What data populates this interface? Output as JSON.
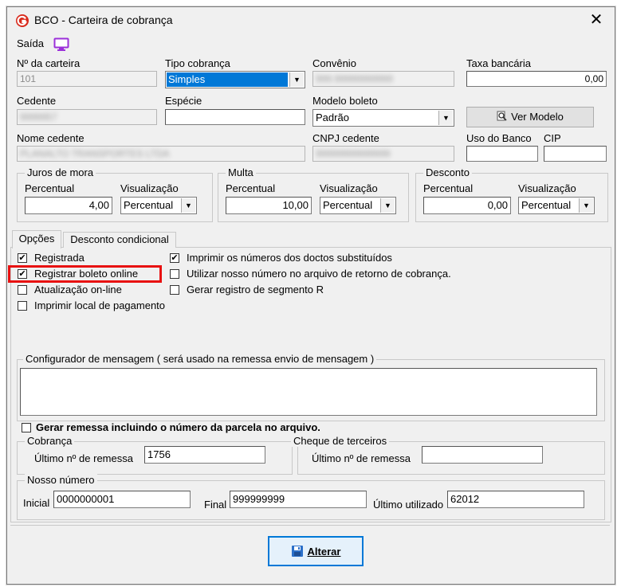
{
  "window": {
    "title": "BCO - Carteira de cobrança",
    "close": "✕",
    "app_icon": "app-g-logo-icon"
  },
  "toolbar": {
    "saida_label": "Saída",
    "monitor_icon": "monitor-icon"
  },
  "fields": {
    "num_carteira": {
      "label": "Nº da carteira",
      "value": "101"
    },
    "tipo_cobranca": {
      "label": "Tipo cobrança",
      "value": "Simples"
    },
    "convenio": {
      "label": "Convênio",
      "value": "999.99999999999"
    },
    "taxa_bancaria": {
      "label": "Taxa bancária",
      "value": "0,00"
    },
    "cedente": {
      "label": "Cedente",
      "value": "9999957"
    },
    "especie": {
      "label": "Espécie",
      "value": ""
    },
    "modelo_boleto": {
      "label": "Modelo boleto",
      "value": "Padrão"
    },
    "ver_modelo": {
      "label": "Ver Modelo"
    },
    "nome_cedente": {
      "label": "Nome cedente",
      "value": "PLANALTO TRANSPORTES LTDA"
    },
    "cnpj_cedente": {
      "label": "CNPJ cedente",
      "value": "99999999999999"
    },
    "uso_banco": {
      "label": "Uso do Banco",
      "value": ""
    },
    "cip": {
      "label": "CIP",
      "value": ""
    }
  },
  "juros": {
    "title": "Juros de mora",
    "percentual_label": "Percentual",
    "percentual": "4,00",
    "vis_label": "Visualização",
    "vis_value": "Percentual"
  },
  "multa": {
    "title": "Multa",
    "percentual_label": "Percentual",
    "percentual": "10,00",
    "vis_label": "Visualização",
    "vis_value": "Percentual"
  },
  "desconto": {
    "title": "Desconto",
    "percentual_label": "Percentual",
    "percentual": "0,00",
    "vis_label": "Visualização",
    "vis_value": "Percentual"
  },
  "tabs": [
    {
      "label": "Opções"
    },
    {
      "label": "Desconto condicional"
    }
  ],
  "options": {
    "registrada": {
      "label": "Registrada",
      "checked": true
    },
    "registrar_online": {
      "label": "Registrar boleto online",
      "checked": true
    },
    "atualizacao_online": {
      "label": "Atualização on-line",
      "checked": false
    },
    "imprimir_local": {
      "label": "Imprimir local de pagamento",
      "checked": false
    },
    "imprimir_numeros": {
      "label": "Imprimir os números dos doctos substituídos",
      "checked": true
    },
    "utilizar_nosso_numero": {
      "label": "Utilizar nosso número no arquivo de retorno de cobrança.",
      "checked": false
    },
    "gerar_segmento_r": {
      "label": "Gerar registro de segmento R",
      "checked": false
    }
  },
  "configurador": {
    "title": "Configurador de mensagem ( será usado na remessa envio de mensagem )",
    "value": ""
  },
  "gerar_remessa": {
    "label": "Gerar remessa incluindo o número da parcela no arquivo.",
    "checked": false
  },
  "cobranca": {
    "title": "Cobrança",
    "ultimo_label": "Último nº  de remessa",
    "ultimo_value": "1756"
  },
  "cheque": {
    "title": "Cheque de terceiros",
    "ultimo_label": "Último nº  de remessa",
    "ultimo_value": ""
  },
  "nosso_numero": {
    "title": "Nosso número",
    "inicial_label": "Inicial",
    "inicial_value": "0000000001",
    "final_label": "Final",
    "final_value": "999999999",
    "ultimo_label": "Último utilizado",
    "ultimo_value": "62012"
  },
  "alterar_button": {
    "label": "Alterar",
    "icon": "save-disk-icon"
  },
  "highlight_color": "#e81010"
}
